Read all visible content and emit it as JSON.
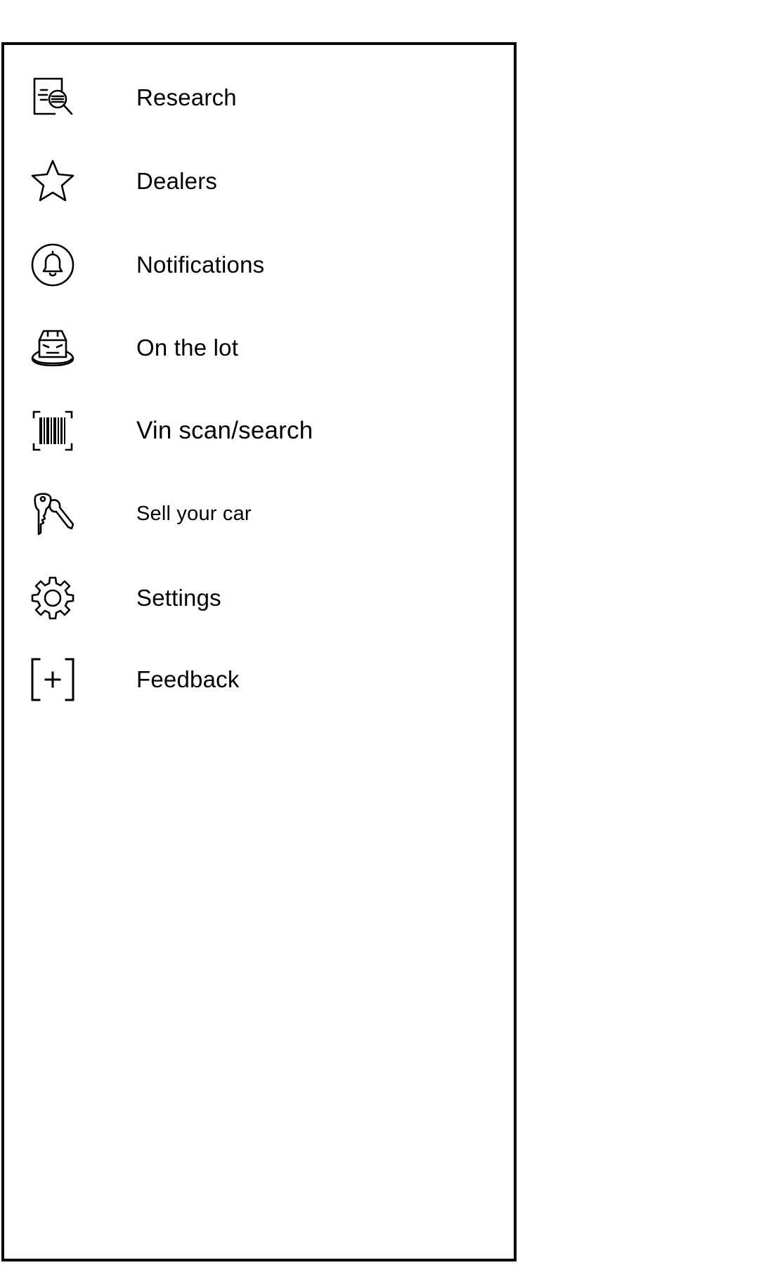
{
  "colors": {
    "background": "#ffffff",
    "foreground": "#000000",
    "border": "#000000"
  },
  "menu": {
    "items": [
      {
        "label": "Research",
        "icon": "research-document-search-icon"
      },
      {
        "label": "Dealers",
        "icon": "star-icon"
      },
      {
        "label": "Notifications",
        "icon": "bell-icon"
      },
      {
        "label": "On the lot",
        "icon": "car-on-turntable-icon"
      },
      {
        "label": "Vin scan/search",
        "icon": "barcode-scan-icon"
      },
      {
        "label": "Sell your car",
        "icon": "car-key-icon"
      },
      {
        "label": "Settings",
        "icon": "gear-icon"
      },
      {
        "label": "Feedback",
        "icon": "bracket-plus-icon"
      }
    ]
  }
}
